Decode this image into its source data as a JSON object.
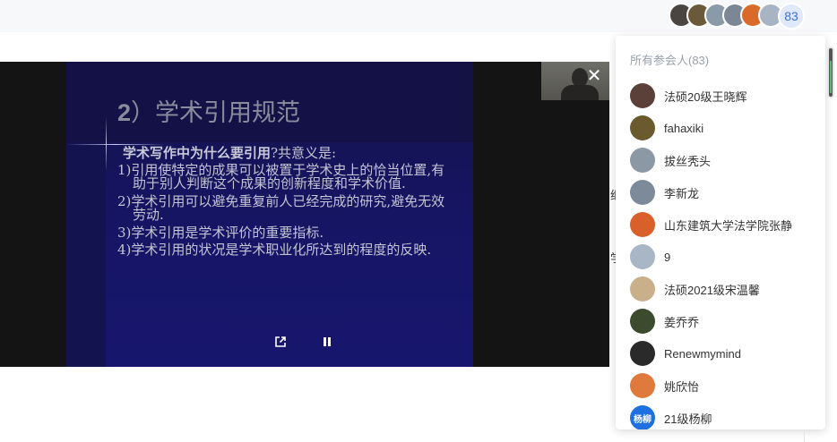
{
  "header": {
    "participant_count_badge": "83",
    "avatar_colors": [
      "#4a4540",
      "#6b5a3a",
      "#8a9aa8",
      "#7c8796",
      "#d96a2a",
      "#a8b4c4"
    ]
  },
  "background": {
    "fragment_1": "继",
    "fragment_2": "学"
  },
  "viewer": {
    "close_label": "✕",
    "slide": {
      "title_number": "2",
      "title_text": "）学术引用规范",
      "question_bold": "学术写作中为什么要引用",
      "question_rest": "?共意义是:",
      "items": [
        "1)引用使特定的成果可以被置于学术史上的恰当位置,有助于别人判断这个成果的创新程度和学术价值.",
        "2)学术引用可以避免重复前人已经完成的研究,避免无效劳动.",
        "3)学术引用是学术评价的重要指标.",
        "4)学术引用的状况是学术职业化所达到的程度的反映."
      ]
    },
    "controls": {
      "popout_icon": "popout-icon",
      "pause_icon": "pause-icon"
    }
  },
  "panel": {
    "title": "所有参会人(83)",
    "participants": [
      {
        "name": "法硕20级王晓辉",
        "avatar_color": "#5a4038",
        "avatar_text": ""
      },
      {
        "name": "fahaxiki",
        "avatar_color": "#6b5a2e",
        "avatar_text": ""
      },
      {
        "name": "拔丝秃头",
        "avatar_color": "#8c98a4",
        "avatar_text": ""
      },
      {
        "name": "李新龙",
        "avatar_color": "#7d8a99",
        "avatar_text": ""
      },
      {
        "name": "山东建筑大学法学院张静",
        "avatar_color": "#d9602a",
        "avatar_text": ""
      },
      {
        "name": "9",
        "avatar_color": "#a9b6c6",
        "avatar_text": ""
      },
      {
        "name": "法硕2021级宋温馨",
        "avatar_color": "#c9b08a",
        "avatar_text": ""
      },
      {
        "name": "姜乔乔",
        "avatar_color": "#3c4a2e",
        "avatar_text": ""
      },
      {
        "name": "Renewmymind",
        "avatar_color": "#2a2a2a",
        "avatar_text": ""
      },
      {
        "name": "姚欣怡",
        "avatar_color": "#e07a3c",
        "avatar_text": ""
      },
      {
        "name": "21级杨柳",
        "avatar_color": "#1e6fe0",
        "avatar_text": "杨柳"
      }
    ]
  }
}
